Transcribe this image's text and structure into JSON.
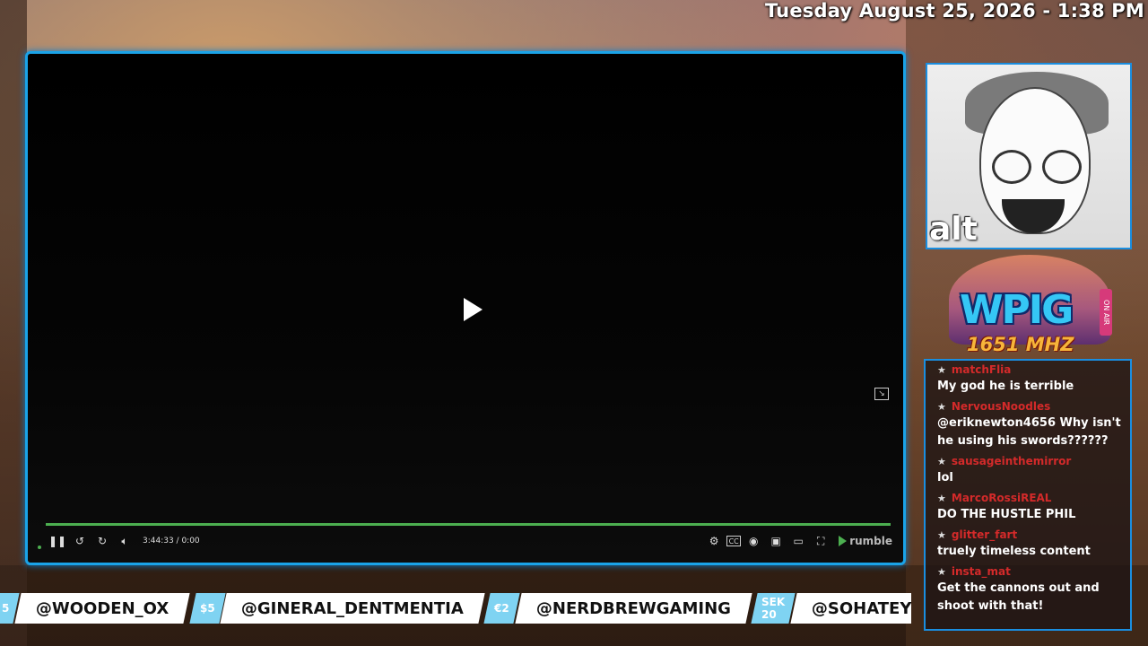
{
  "header": {
    "datetime": "Tuesday August 25, 2026 - 1:38 PM"
  },
  "player": {
    "time": "3:44:33 / 0:00",
    "progress": 1.0,
    "brand": "rumble"
  },
  "webcam": {
    "caption": "alt"
  },
  "station_logo": {
    "name": "WPIG",
    "frequency": "1651 MHZ",
    "badge": "ON AIR"
  },
  "chat": {
    "messages": [
      {
        "user": "matchFlia",
        "text": "My god he is terrible"
      },
      {
        "user": "NervousNoodles",
        "text": "@eriknewton4656 Why isn't he using his swords??????"
      },
      {
        "user": "sausageinthemirror",
        "text": "lol"
      },
      {
        "user": "MarcoRossiREAL",
        "text": "DO THE HUSTLE PHIL"
      },
      {
        "user": "glitter_fart",
        "text": "truely timeless content"
      },
      {
        "user": "insta_mat",
        "text": "Get the cannons out and shoot with that!"
      }
    ]
  },
  "ticker": {
    "items": [
      {
        "badge": "5",
        "name": "@WOODEN_OX"
      },
      {
        "badge": "$5",
        "name": "@GINERAL_DENTMENTIA"
      },
      {
        "badge": "€2",
        "name": "@NERDBREWGAMING"
      },
      {
        "badge": "SEK 20",
        "name": "@SOHATEY"
      }
    ]
  }
}
